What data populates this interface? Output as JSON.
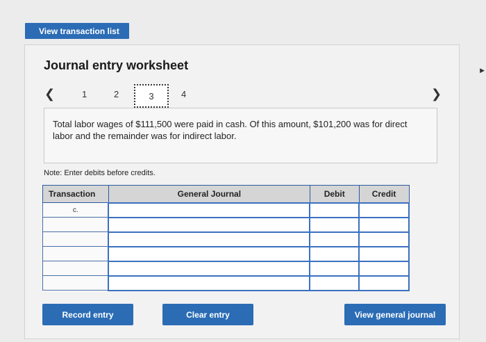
{
  "top": {
    "view_transaction_list": "View transaction list"
  },
  "worksheet": {
    "title": "Journal entry worksheet",
    "pager": {
      "prev_icon": "chevron-left",
      "next_icon": "chevron-right",
      "pages": [
        "1",
        "2",
        "3",
        "4"
      ],
      "current": "3"
    },
    "description": "Total labor wages of $111,500 were paid in cash. Of this amount, $101,200 was for direct labor and the remainder was for indirect labor.",
    "note": "Note: Enter debits before credits.",
    "table": {
      "headers": {
        "transaction": "Transaction",
        "general_journal": "General Journal",
        "debit": "Debit",
        "credit": "Credit"
      },
      "rows": [
        {
          "transaction": "c.",
          "account": "",
          "debit": "",
          "credit": ""
        },
        {
          "transaction": "",
          "account": "",
          "debit": "",
          "credit": ""
        },
        {
          "transaction": "",
          "account": "",
          "debit": "",
          "credit": ""
        },
        {
          "transaction": "",
          "account": "",
          "debit": "",
          "credit": ""
        },
        {
          "transaction": "",
          "account": "",
          "debit": "",
          "credit": ""
        },
        {
          "transaction": "",
          "account": "",
          "debit": "",
          "credit": ""
        }
      ]
    },
    "buttons": {
      "record": "Record entry",
      "clear": "Clear entry",
      "view_general_journal": "View general journal"
    }
  },
  "colors": {
    "accent": "#2b6cb5",
    "panel_bg": "#f2f2f2",
    "header_bg": "#d5d5d5"
  }
}
